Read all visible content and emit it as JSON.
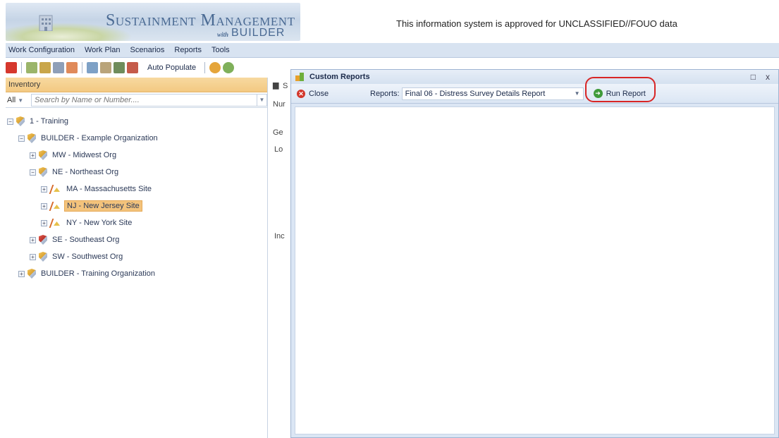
{
  "banner": {
    "title": "Sustainment Management Systems",
    "with": "with",
    "builder": "BUILDER",
    "approval": "This information system is approved for UNCLASSIFIED//FOUO data"
  },
  "menu": {
    "items": [
      "Work Configuration",
      "Work Plan",
      "Scenarios",
      "Reports",
      "Tools"
    ]
  },
  "toolbar": {
    "auto_populate": "Auto Populate"
  },
  "inventory": {
    "header": "Inventory",
    "filter": "All",
    "search_placeholder": "Search by Name or Number....",
    "tree": [
      {
        "label": "1 - Training"
      },
      {
        "label": "BUILDER - Example Organization"
      },
      {
        "label": "MW - Midwest Org"
      },
      {
        "label": "NE - Northeast Org"
      },
      {
        "label": "MA - Massachusetts Site"
      },
      {
        "label": "NJ - New Jersey Site"
      },
      {
        "label": "NY - New York Site"
      },
      {
        "label": "SE - Southeast Org"
      },
      {
        "label": "SW - Southwest Org"
      },
      {
        "label": "BUILDER - Training Organization"
      }
    ]
  },
  "behind": {
    "s": "S",
    "num": "Nur",
    "ge": "Ge",
    "lo": "Lo",
    "in": "Inc"
  },
  "reports_window": {
    "title": "Custom Reports",
    "close": "Close",
    "reports_label": "Reports:",
    "selected_report": "Final 06 - Distress Survey Details Report",
    "run_report": "Run Report"
  }
}
